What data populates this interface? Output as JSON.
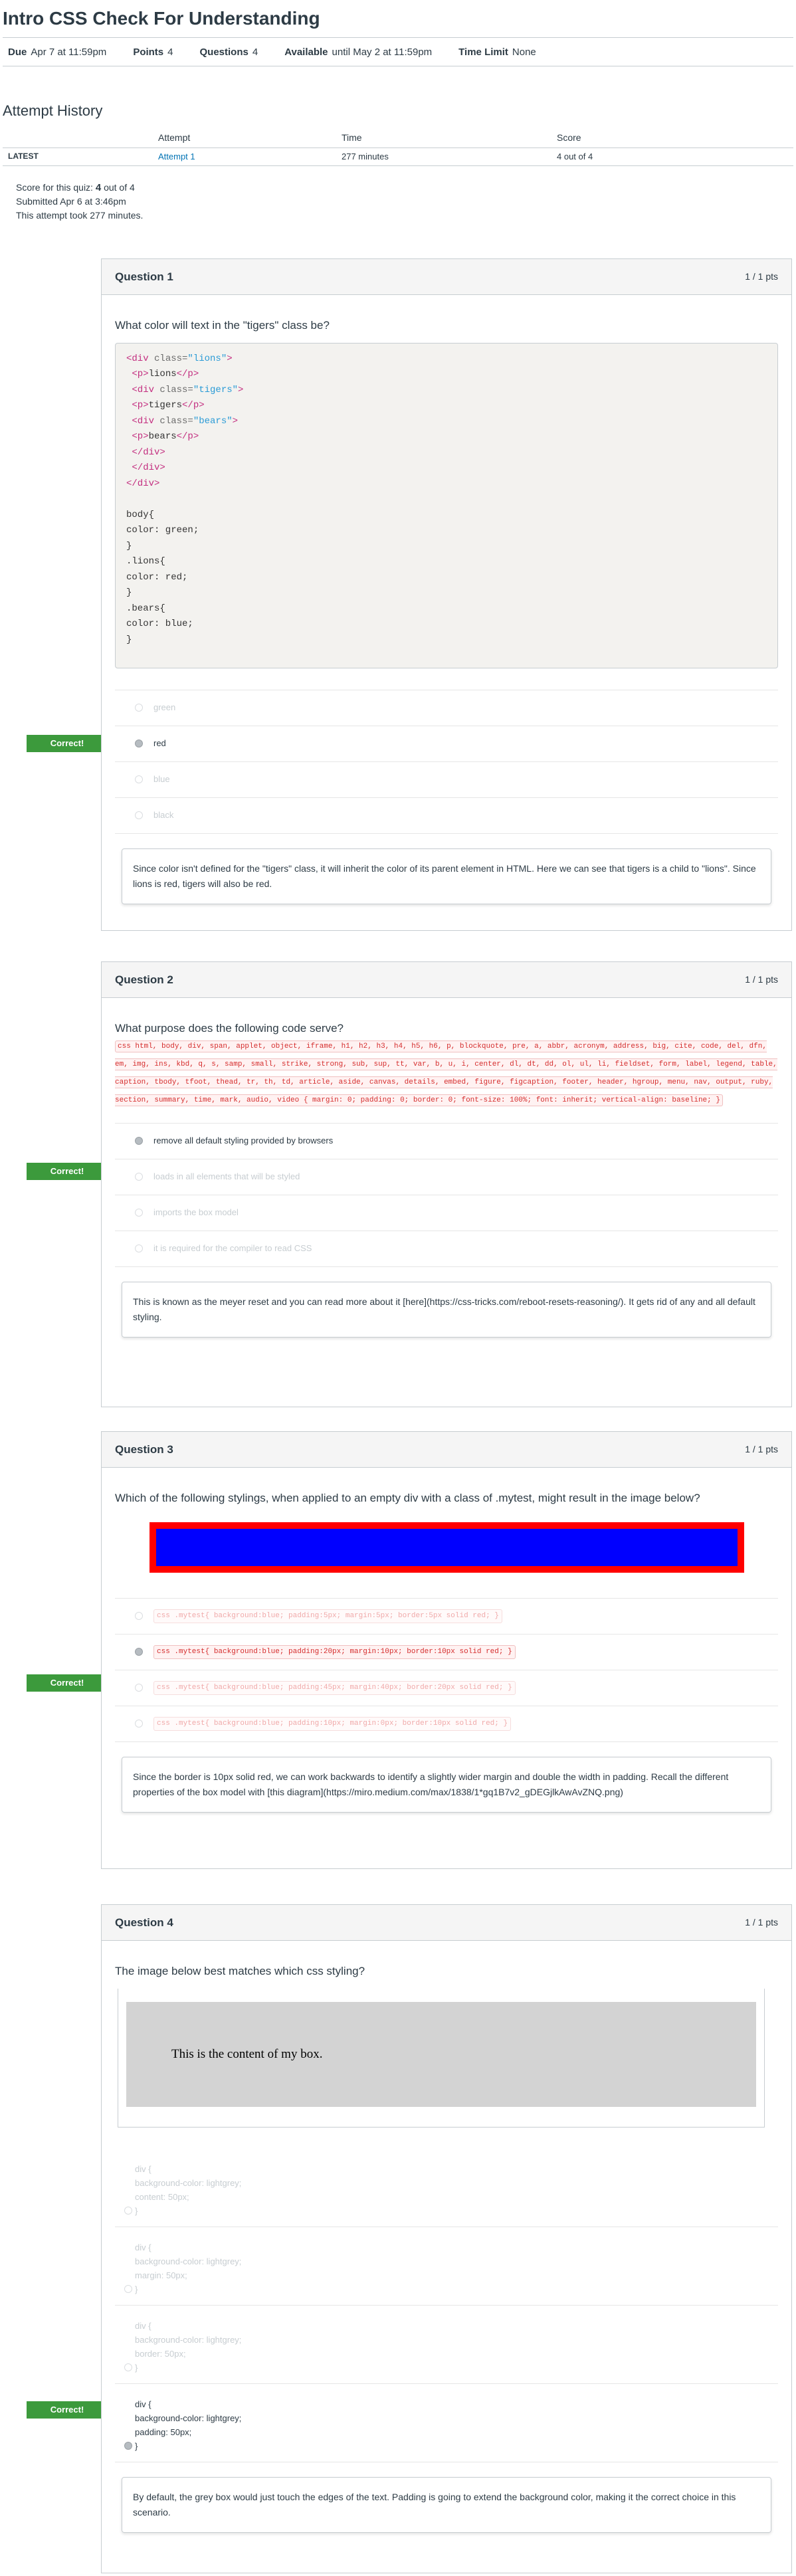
{
  "quiz": {
    "title": "Intro CSS Check For Understanding",
    "due_label": "Due",
    "due_value": "Apr 7 at 11:59pm",
    "points_label": "Points",
    "points_value": "4",
    "questions_label": "Questions",
    "questions_value": "4",
    "available_label": "Available",
    "available_value": "until May 2 at 11:59pm",
    "time_limit_label": "Time Limit",
    "time_limit_value": "None"
  },
  "attempt_history": {
    "title": "Attempt History",
    "columns": [
      "",
      "Attempt",
      "Time",
      "Score"
    ],
    "row": {
      "label": "LATEST",
      "attempt": "Attempt 1",
      "time": "277 minutes",
      "score": "4 out of 4"
    }
  },
  "summary": {
    "score_prefix": "Score for this quiz:",
    "score_value": "4",
    "score_suffix": "out of 4",
    "submitted": "Submitted Apr 6 at 3:46pm",
    "took": "This attempt took 277 minutes."
  },
  "correct_label": "Correct!",
  "questions": [
    {
      "name": "Question 1",
      "points": "1 / 1 pts",
      "text": "What color will text in the \"tigers\" class be?",
      "answers": [
        "green",
        "red",
        "blue",
        "black"
      ],
      "feedback": "Since color isn't defined for the \"tigers\" class, it will inherit the color of its parent element in HTML. Here we can see that tigers is a child to \"lions\". Since lions is red, tigers will also be red."
    },
    {
      "name": "Question 2",
      "points": "1 / 1 pts",
      "text": "What purpose does the following code serve?",
      "code": "css html, body, div, span, applet, object, iframe, h1, h2, h3, h4, h5, h6, p, blockquote, pre, a, abbr, acronym, address, big, cite, code, del, dfn, em, img, ins, kbd, q, s, samp, small, strike, strong, sub, sup, tt, var, b, u, i, center, dl, dt, dd, ol, ul, li, fieldset, form, label, legend, table, caption, tbody, tfoot, thead, tr, th, td, article, aside, canvas, details, embed, figure, figcaption, footer, header, hgroup, menu, nav, output, ruby, section, summary, time, mark, audio, video { margin: 0; padding: 0; border: 0; font-size: 100%; font: inherit; vertical-align: baseline; }",
      "answers": [
        "remove all default styling provided by browsers",
        "loads in all elements that will be styled",
        "imports the box model",
        "it is required for the compiler to read CSS"
      ],
      "feedback": "This is known as the meyer reset and you can read more about it [here](https://css-tricks.com/reboot-resets-reasoning/). It gets rid of any and all default styling."
    },
    {
      "name": "Question 3",
      "points": "1 / 1 pts",
      "text": "Which of the following stylings, when applied to an empty div with a class of .mytest, might result in the image below?",
      "answers": [
        "css .mytest{ background:blue; padding:5px; margin:5px; border:5px solid red; }",
        "css .mytest{ background:blue; padding:20px; margin:10px; border:10px solid red; }",
        "css .mytest{ background:blue; padding:45px; margin:40px; border:20px solid red; }",
        "css .mytest{ background:blue; padding:10px; margin:0px; border:10px solid red; }"
      ],
      "feedback": "Since the border is 10px solid red, we can work backwards to identify a slightly wider margin and double the width in padding. Recall the different properties of the box model with [this diagram](https://miro.medium.com/max/1838/1*gq1B7v2_gDEGjlkAwAvZNQ.png)"
    },
    {
      "name": "Question 4",
      "points": "1 / 1 pts",
      "text": "The image below best matches which css styling?",
      "image_text": "This is the content of my box.",
      "answers": [
        [
          "div {",
          "background-color: lightgrey;",
          "content: 50px;",
          "}"
        ],
        [
          "div {",
          "background-color: lightgrey;",
          "margin: 50px;",
          "}"
        ],
        [
          "div {",
          "background-color: lightgrey;",
          "border: 50px;",
          "}"
        ],
        [
          "div {",
          "background-color: lightgrey;",
          "padding: 50px;",
          "}"
        ]
      ],
      "feedback": "By default, the grey box would just touch the edges of the text. Padding is going to extend the background color, making it the correct choice in this scenario."
    }
  ],
  "q1_code": {
    "l1_open": "<div",
    "l1_attr": " class=",
    "l1_val": "\"lions\"",
    "l1_close": ">",
    "l2_open": " <p>",
    "l2_text": "lions",
    "l2_close": "</p>",
    "l3_open": " <div",
    "l3_attr": " class=",
    "l3_val": "\"tigers\"",
    "l3_close": ">",
    "l4_open": " <p>",
    "l4_text": "tigers",
    "l4_close": "</p>",
    "l5_open": " <div",
    "l5_attr": " class=",
    "l5_val": "\"bears\"",
    "l5_close": ">",
    "l6_open": " <p>",
    "l6_text": "bears",
    "l6_close": "</p>",
    "l7": " </div>",
    "l8": " </div>",
    "l9": "</div>",
    "css": [
      "body{",
      "color: green;",
      "}",
      ".lions{",
      "color: red;",
      "}",
      ".bears{",
      "color: blue;",
      "}"
    ]
  },
  "colors": {
    "correct": "#3c9a3c",
    "link": "#0374b5",
    "q3_border": "#ff0000",
    "q3_fill": "#0000ff",
    "q4_box": "#d3d3d3"
  }
}
